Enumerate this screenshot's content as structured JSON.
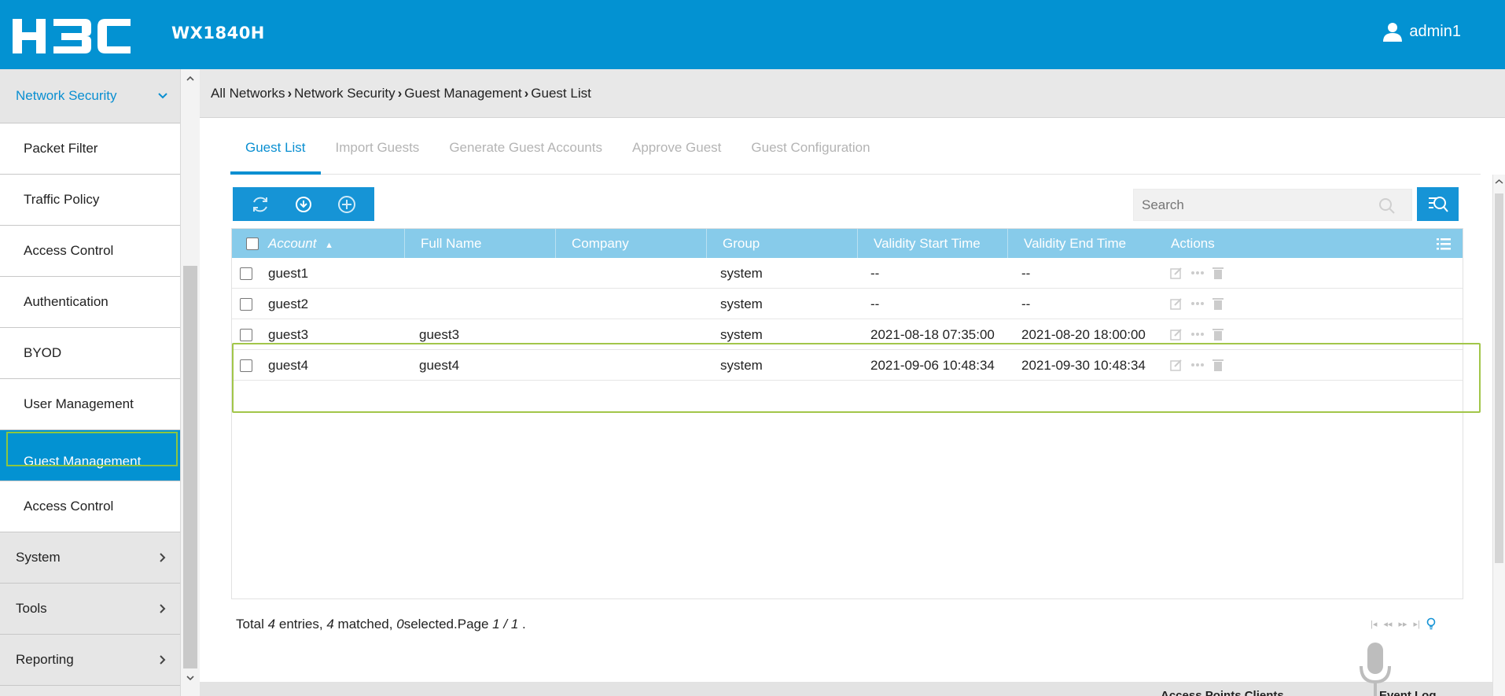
{
  "header": {
    "logo_text": "H3C",
    "product": "WX1840H",
    "user": "admin1"
  },
  "sidebar": {
    "items": [
      {
        "label": "Network Security",
        "type": "group-open"
      },
      {
        "label": "Packet Filter",
        "type": "sub"
      },
      {
        "label": "Traffic Policy",
        "type": "sub"
      },
      {
        "label": "Access Control",
        "type": "sub"
      },
      {
        "label": "Authentication",
        "type": "sub"
      },
      {
        "label": "BYOD",
        "type": "sub"
      },
      {
        "label": "User Management",
        "type": "sub"
      },
      {
        "label": "Guest Management",
        "type": "active"
      },
      {
        "label": "Access Control",
        "type": "sub"
      },
      {
        "label": "System",
        "type": "group"
      },
      {
        "label": "Tools",
        "type": "group"
      },
      {
        "label": "Reporting",
        "type": "group"
      }
    ]
  },
  "breadcrumb": [
    "All Networks",
    "Network Security",
    "Guest Management",
    "Guest List"
  ],
  "tabs": [
    "Guest List",
    "Import Guests",
    "Generate Guest Accounts",
    "Approve Guest",
    "Guest Configuration"
  ],
  "search": {
    "placeholder": "Search"
  },
  "table": {
    "columns": [
      "Account",
      "Full Name",
      "Company",
      "Group",
      "Validity Start Time",
      "Validity End Time",
      "Actions"
    ],
    "rows": [
      {
        "account": "guest1",
        "full_name": "",
        "company": "",
        "group": "system",
        "start": "--",
        "end": "--"
      },
      {
        "account": "guest2",
        "full_name": "",
        "company": "",
        "group": "system",
        "start": "--",
        "end": "--"
      },
      {
        "account": "guest3",
        "full_name": "guest3",
        "company": "",
        "group": "system",
        "start": "2021-08-18 07:35:00",
        "end": "2021-08-20 18:00:00"
      },
      {
        "account": "guest4",
        "full_name": "guest4",
        "company": "",
        "group": "system",
        "start": "2021-09-06 10:48:34",
        "end": "2021-09-30 10:48:34"
      }
    ]
  },
  "footer": {
    "total_label": "Total",
    "total": "4",
    "entries_label": "entries,",
    "matched": "4",
    "matched_label": "matched,",
    "selected": "0",
    "selected_label": "selected.Page",
    "page": "1",
    "page_sep": "/",
    "pages": "1",
    "end": "."
  },
  "bottom": {
    "text1": "Access Points      Clients",
    "text2": "Event Log"
  },
  "colors": {
    "brand": "#0392d2",
    "table_header": "#87cbea",
    "highlight": "#8dc63f"
  }
}
